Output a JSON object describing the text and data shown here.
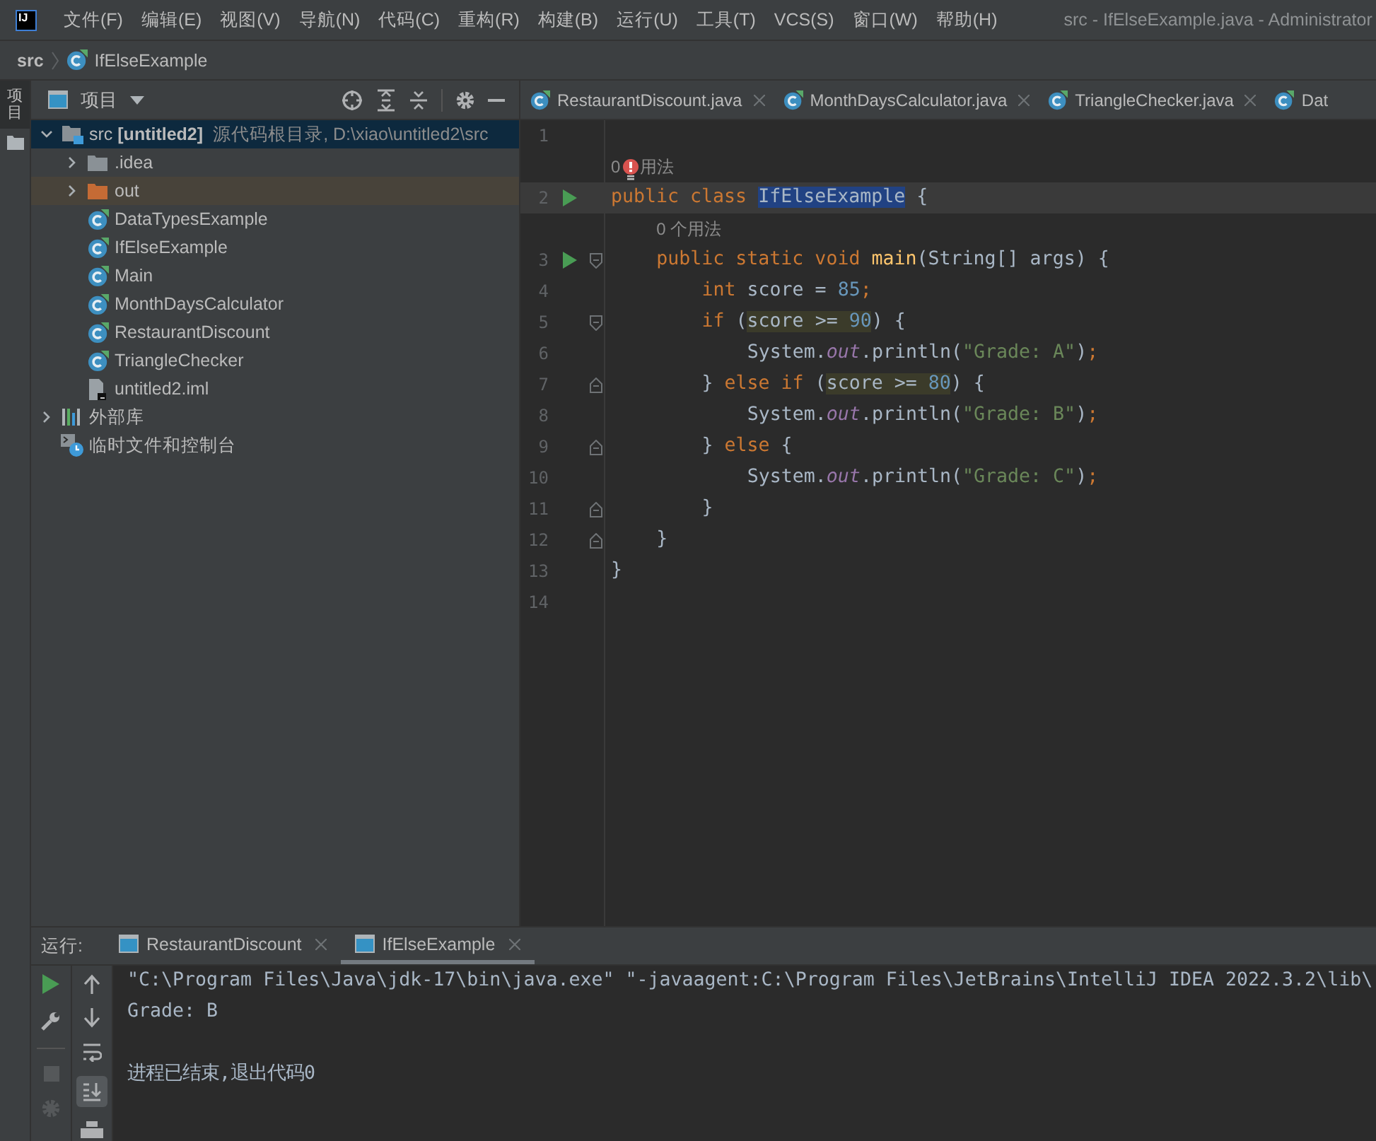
{
  "menu_bar": {
    "logo_text": "IJ",
    "menus": [
      "文件(F)",
      "编辑(E)",
      "视图(V)",
      "导航(N)",
      "代码(C)",
      "重构(R)",
      "构建(B)",
      "运行(U)",
      "工具(T)",
      "VCS(S)",
      "窗口(W)",
      "帮助(H)"
    ],
    "title": "src - IfElseExample.java - Administrator"
  },
  "breadcrumb": [
    {
      "label": "src",
      "kind": "module"
    },
    {
      "label": "IfElseExample",
      "kind": "class"
    }
  ],
  "tool_strip": {
    "label": "项目",
    "selected": true
  },
  "project_panel": {
    "title": "项目",
    "tree": [
      {
        "label": "src **[untitled2]**",
        "note": "源代码根目录, D:\\xiao\\untitled2\\src",
        "kind": "source_root",
        "expanded": true,
        "selected": true,
        "children": [
          {
            "label": ".idea",
            "kind": "folder",
            "expanded": false,
            "selected": false
          },
          {
            "label": "out",
            "kind": "excluded_folder",
            "expanded": false,
            "selected": false
          },
          {
            "label": "DataTypesExample",
            "kind": "class",
            "selected": false
          },
          {
            "label": "IfElseExample",
            "kind": "class",
            "selected": false
          },
          {
            "label": "Main",
            "kind": "class",
            "selected": false
          },
          {
            "label": "MonthDaysCalculator",
            "kind": "class",
            "selected": false
          },
          {
            "label": "RestaurantDiscount",
            "kind": "class",
            "selected": false
          },
          {
            "label": "TriangleChecker",
            "kind": "class",
            "selected": false
          },
          {
            "label": "untitled2.iml",
            "kind": "module_file",
            "selected": false
          }
        ]
      },
      {
        "label": "外部库",
        "kind": "library",
        "expanded": false,
        "selected": false
      },
      {
        "label": "临时文件和控制台",
        "kind": "scratches",
        "selected": false
      }
    ]
  },
  "editor": {
    "tabs": [
      {
        "label": "RestaurantDiscount.java",
        "selected": false,
        "closable": true
      },
      {
        "label": "MonthDaysCalculator.java",
        "selected": false,
        "closable": true
      },
      {
        "label": "TriangleChecker.java",
        "selected": false,
        "closable": true
      },
      {
        "label": "Dat",
        "selected": false,
        "closable": false
      }
    ],
    "lines": [
      {
        "number": "1",
        "current": false
      },
      {
        "number": "2",
        "current": true,
        "gutter": [
          {
            "kind": "run"
          }
        ],
        "hint": [
          {
            "kind": "text",
            "text": "0"
          },
          {
            "kind": "bulb"
          },
          {
            "kind": "text",
            "text": "用法"
          }
        ],
        "tokens": [
          {
            "text": "public class ",
            "kind": "keyword"
          },
          {
            "text": "IfElseExample",
            "kind": "selected"
          },
          {
            "text": " {",
            "kind": "plain"
          }
        ],
        "children": [
          {
            "number": "3",
            "current": false,
            "gutter": [
              {
                "kind": "run"
              },
              {
                "kind": "fold_open"
              }
            ],
            "hint": [
              {
                "kind": "text",
                "text": "0 个用法"
              }
            ],
            "tokens": [
              {
                "text": "public static void ",
                "kind": "keyword"
              },
              {
                "text": "main",
                "kind": "method"
              },
              {
                "text": "(String[] args) {",
                "kind": "plain"
              }
            ],
            "children": [
              {
                "number": "4",
                "current": false,
                "tokens": [
                  {
                    "text": "int ",
                    "kind": "keyword"
                  },
                  {
                    "text": "score = ",
                    "kind": "plain"
                  },
                  {
                    "text": "85",
                    "kind": "number"
                  },
                  {
                    "text": ";",
                    "kind": "semicolon"
                  }
                ]
              },
              {
                "number": "5",
                "current": false,
                "gutter": [
                  {
                    "kind": "fold_open"
                  }
                ],
                "tokens": [
                  {
                    "text": "if ",
                    "kind": "keyword"
                  },
                  {
                    "text": "(",
                    "kind": "plain"
                  },
                  {
                    "text": "score >= ",
                    "kind": "match"
                  },
                  {
                    "text": "90",
                    "kind": "match_number"
                  },
                  {
                    "text": ") {",
                    "kind": "plain"
                  }
                ],
                "children": [
                  {
                    "number": "6",
                    "current": false,
                    "tokens": [
                      {
                        "text": "System.",
                        "kind": "plain"
                      },
                      {
                        "text": "out",
                        "kind": "field"
                      },
                      {
                        "text": ".println(",
                        "kind": "plain"
                      },
                      {
                        "text": "\"Grade: A\"",
                        "kind": "string"
                      },
                      {
                        "text": ")",
                        "kind": "plain"
                      },
                      {
                        "text": ";",
                        "kind": "semicolon"
                      }
                    ]
                  }
                ]
              },
              {
                "number": "7",
                "current": false,
                "gutter": [
                  {
                    "kind": "fold_close"
                  }
                ],
                "tokens": [
                  {
                    "text": "} ",
                    "kind": "plain"
                  },
                  {
                    "text": "else if ",
                    "kind": "keyword"
                  },
                  {
                    "text": "(",
                    "kind": "plain"
                  },
                  {
                    "text": "score >= ",
                    "kind": "match"
                  },
                  {
                    "text": "80",
                    "kind": "match_number"
                  },
                  {
                    "text": ") {",
                    "kind": "plain"
                  }
                ],
                "children": [
                  {
                    "number": "8",
                    "current": false,
                    "tokens": [
                      {
                        "text": "System.",
                        "kind": "plain"
                      },
                      {
                        "text": "out",
                        "kind": "field"
                      },
                      {
                        "text": ".println(",
                        "kind": "plain"
                      },
                      {
                        "text": "\"Grade: B\"",
                        "kind": "string"
                      },
                      {
                        "text": ")",
                        "kind": "plain"
                      },
                      {
                        "text": ";",
                        "kind": "semicolon"
                      }
                    ]
                  }
                ]
              },
              {
                "number": "9",
                "current": false,
                "gutter": [
                  {
                    "kind": "fold_close"
                  }
                ],
                "tokens": [
                  {
                    "text": "} ",
                    "kind": "plain"
                  },
                  {
                    "text": "else ",
                    "kind": "keyword"
                  },
                  {
                    "text": "{",
                    "kind": "plain"
                  }
                ],
                "children": [
                  {
                    "number": "10",
                    "current": false,
                    "tokens": [
                      {
                        "text": "System.",
                        "kind": "plain"
                      },
                      {
                        "text": "out",
                        "kind": "field"
                      },
                      {
                        "text": ".println(",
                        "kind": "plain"
                      },
                      {
                        "text": "\"Grade: C\"",
                        "kind": "string"
                      },
                      {
                        "text": ")",
                        "kind": "plain"
                      },
                      {
                        "text": ";",
                        "kind": "semicolon"
                      }
                    ]
                  }
                ]
              },
              {
                "number": "11",
                "current": false,
                "gutter": [
                  {
                    "kind": "fold_close"
                  }
                ],
                "tokens": [
                  {
                    "text": "}",
                    "kind": "plain"
                  }
                ]
              }
            ]
          },
          {
            "number": "12",
            "current": false,
            "gutter": [
              {
                "kind": "fold_close"
              }
            ],
            "tokens": [
              {
                "text": "}",
                "kind": "plain"
              }
            ]
          }
        ]
      },
      {
        "number": "13",
        "current": false,
        "tokens": [
          {
            "text": "}",
            "kind": "plain"
          }
        ]
      },
      {
        "number": "14",
        "current": false
      }
    ]
  },
  "run_panel": {
    "label": "运行:",
    "tabs": [
      {
        "label": "RestaurantDiscount",
        "selected": false
      },
      {
        "label": "IfElseExample",
        "selected": true
      }
    ],
    "output": [
      {
        "text": "\"C:\\Program Files\\Java\\jdk-17\\bin\\java.exe\" \"-javaagent:C:\\Program Files\\JetBrains\\IntelliJ IDEA 2022.3.2\\lib\\",
        "kind": "command"
      },
      {
        "text": "Grade: B",
        "kind": "stdout"
      },
      {
        "text": "进程已结束,退出代码0",
        "kind": "exit"
      }
    ]
  }
}
